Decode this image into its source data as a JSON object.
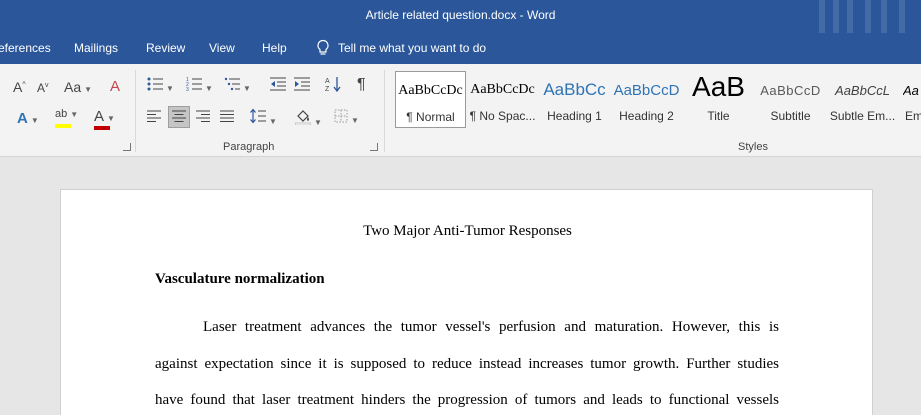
{
  "window": {
    "title": "Article related question.docx  -  Word"
  },
  "menu": {
    "tabs": [
      "eferences",
      "Mailings",
      "Review",
      "View",
      "Help"
    ],
    "tell_me": "Tell me what you want to do"
  },
  "ribbon": {
    "font": {
      "grow_label": "A",
      "shrink_label": "A",
      "change_case_label": "Aa",
      "clear_label": "A",
      "effects_label": "A",
      "highlight_label": "ab",
      "font_color_label": "A"
    },
    "paragraph": {
      "label": "Paragraph",
      "pilcrow": "¶"
    },
    "styles": {
      "label": "Styles",
      "items": [
        {
          "sample": "AaBbCcDc",
          "name": "¶ Normal"
        },
        {
          "sample": "AaBbCcDc",
          "name": "¶ No Spac..."
        },
        {
          "sample": "AaBbCc",
          "name": "Heading 1"
        },
        {
          "sample": "AaBbCcD",
          "name": "Heading 2"
        },
        {
          "sample": "AaB",
          "name": "Title"
        },
        {
          "sample": "AaBbCcD",
          "name": "Subtitle"
        },
        {
          "sample": "AaBbCcL",
          "name": "Subtle Em..."
        },
        {
          "sample": "Aa",
          "name": "Em"
        }
      ],
      "colors": {
        "heading": "#2e74b5",
        "subtitle": "#595959"
      }
    },
    "accent_colors": {
      "highlight": "#ffff00",
      "font_color": "#c00000"
    }
  },
  "document": {
    "title": "Two Major Anti-Tumor Responses",
    "heading": "Vasculature normalization",
    "lines": [
      "Laser treatment advances the tumor vessel's perfusion and maturation. However, this is",
      "against expectation since it is supposed to reduce instead increases tumor growth. Further studies",
      "have found that laser treatment hinders the progression of tumors and leads to functional vessels"
    ]
  },
  "colors": {
    "brand": "#2b579a"
  }
}
